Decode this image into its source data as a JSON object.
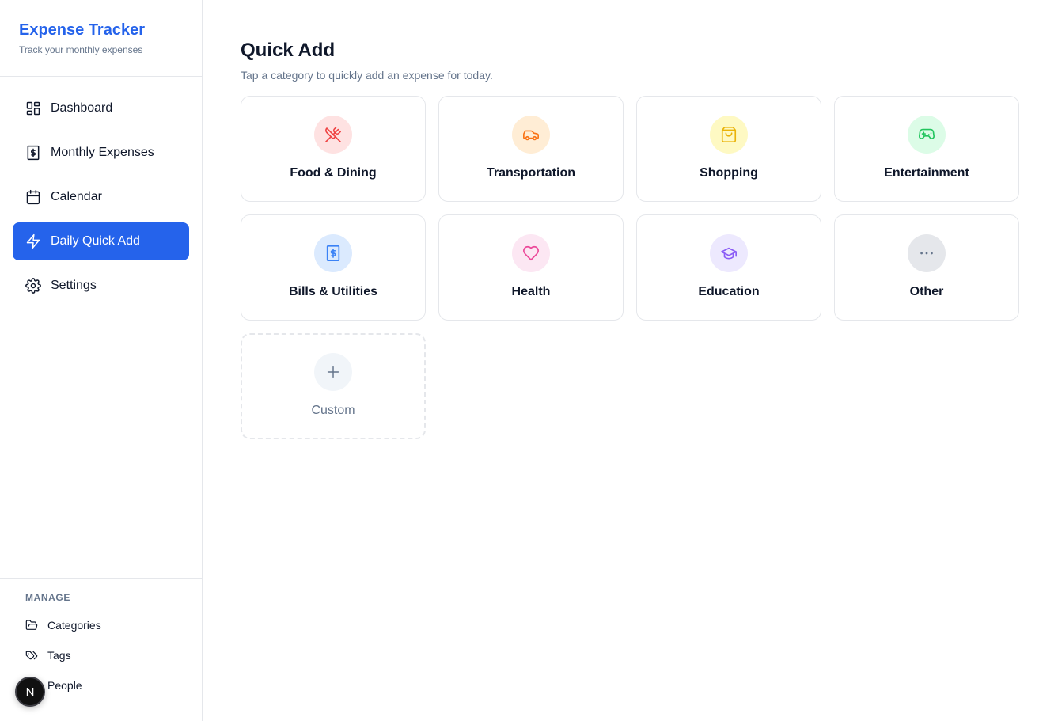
{
  "brand": {
    "title": "Expense Tracker",
    "subtitle": "Track your monthly expenses"
  },
  "nav": {
    "items": [
      {
        "label": "Dashboard",
        "icon": "layout-dashboard-icon"
      },
      {
        "label": "Monthly Expenses",
        "icon": "receipt-icon"
      },
      {
        "label": "Calendar",
        "icon": "calendar-icon"
      },
      {
        "label": "Daily Quick Add",
        "icon": "lightning-icon",
        "active": true
      },
      {
        "label": "Settings",
        "icon": "gear-icon"
      }
    ]
  },
  "manage": {
    "heading": "MANAGE",
    "items": [
      {
        "label": "Categories",
        "icon": "folder-icon"
      },
      {
        "label": "Tags",
        "icon": "tag-icon"
      },
      {
        "label": "People",
        "icon": "people-icon"
      }
    ]
  },
  "badge": {
    "letter": "N"
  },
  "main": {
    "title": "Quick Add",
    "subtitle": "Tap a category to quickly add an expense for today.",
    "categories": [
      {
        "label": "Food & Dining",
        "icon": "utensils-icon",
        "color": "#ef4444",
        "bg": "#fee2e2"
      },
      {
        "label": "Transportation",
        "icon": "car-icon",
        "color": "#f97316",
        "bg": "#ffedd5"
      },
      {
        "label": "Shopping",
        "icon": "shopping-bag-icon",
        "color": "#eab308",
        "bg": "#fef9c3"
      },
      {
        "label": "Entertainment",
        "icon": "gamepad-icon",
        "color": "#22c55e",
        "bg": "#dcfce7"
      },
      {
        "label": "Bills & Utilities",
        "icon": "receipt-icon",
        "color": "#3b82f6",
        "bg": "#dbeafe"
      },
      {
        "label": "Health",
        "icon": "heart-icon",
        "color": "#ec4899",
        "bg": "#fce7f3"
      },
      {
        "label": "Education",
        "icon": "graduation-cap-icon",
        "color": "#8b5cf6",
        "bg": "#ede9fe"
      },
      {
        "label": "Other",
        "icon": "more-horizontal-icon",
        "color": "#64748b",
        "bg": "#f1f5f9"
      }
    ],
    "custom": {
      "label": "Custom",
      "icon": "plus-icon",
      "color": "#64748b",
      "bg": "#f1f5f9"
    }
  },
  "colors": {
    "accent": "#2563eb",
    "muted_text": "#64748b",
    "border": "#e5e7eb"
  }
}
